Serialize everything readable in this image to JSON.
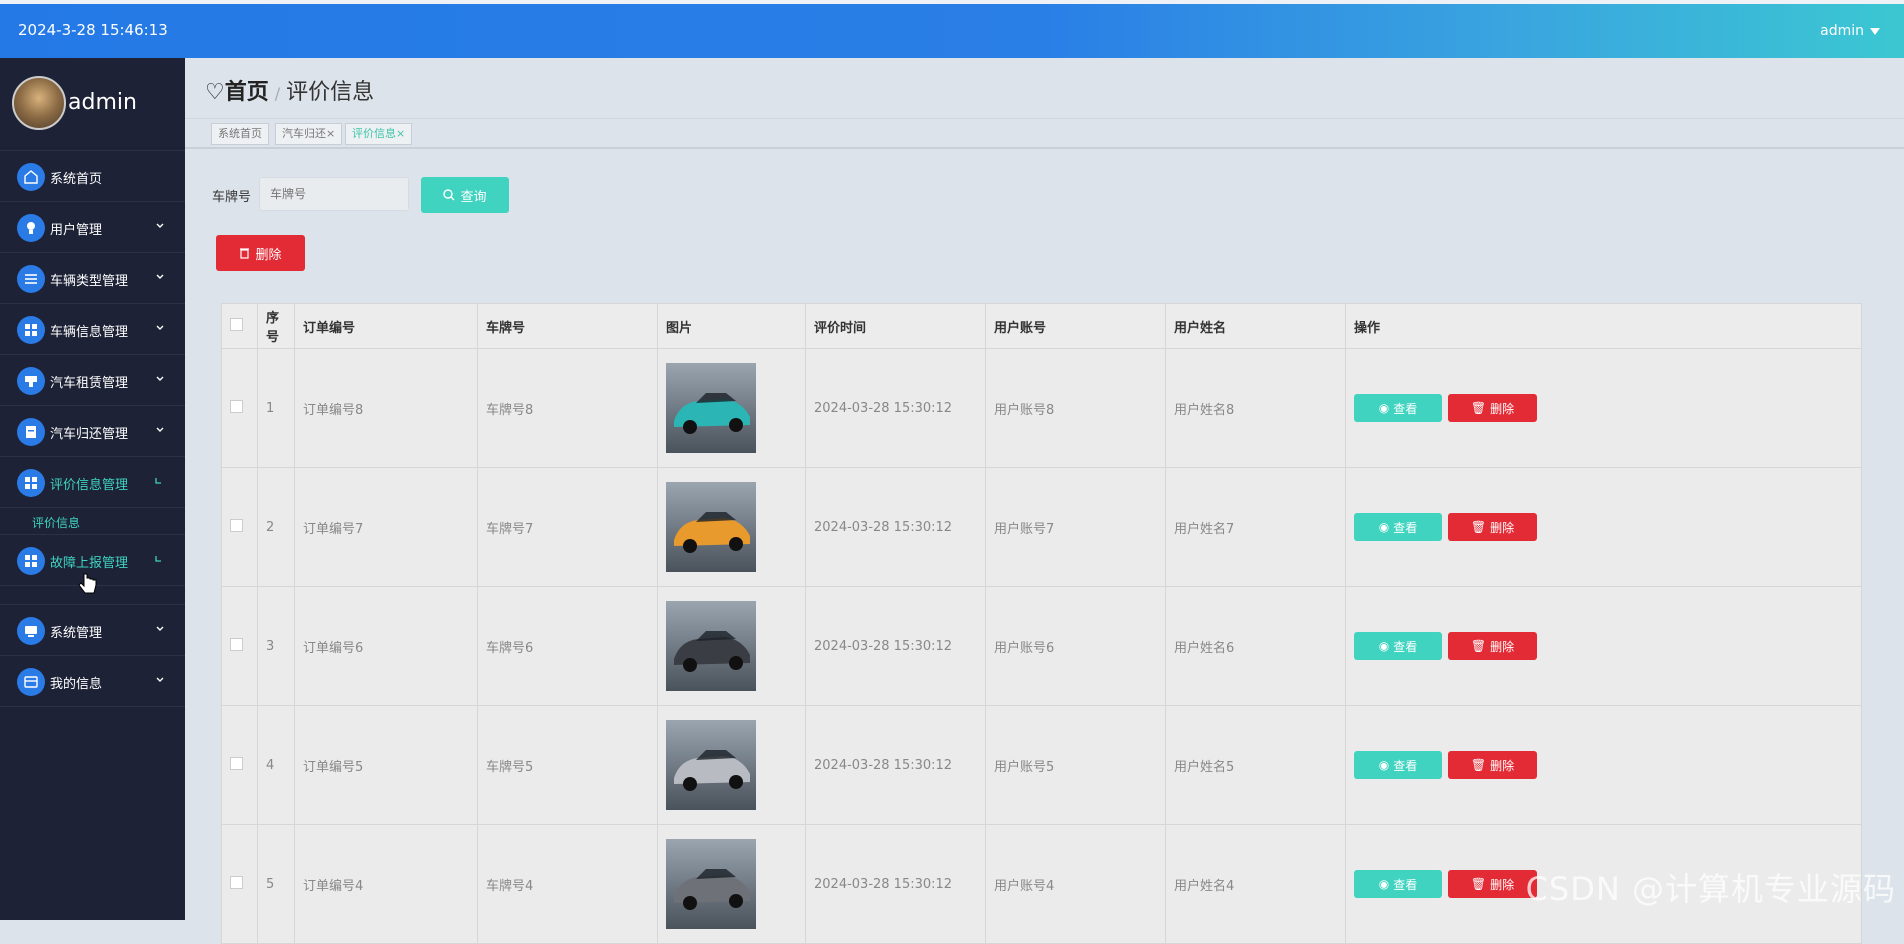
{
  "header": {
    "datetime": "2024-3-28 15:46:13",
    "user": "admin"
  },
  "sidebar": {
    "username": "admin",
    "items": [
      {
        "label": "系统首页",
        "icon": "home-icon",
        "expanded": false
      },
      {
        "label": "用户管理",
        "icon": "user-icon",
        "expanded": false
      },
      {
        "label": "车辆类型管理",
        "icon": "list-icon",
        "expanded": false
      },
      {
        "label": "车辆信息管理",
        "icon": "grid-icon",
        "expanded": false
      },
      {
        "label": "汽车租赁管理",
        "icon": "rent-icon",
        "expanded": false
      },
      {
        "label": "汽车归还管理",
        "icon": "return-icon",
        "expanded": false
      },
      {
        "label": "评价信息管理",
        "icon": "grid-icon",
        "expanded": true,
        "sub": "评价信息"
      },
      {
        "label": "故障上报管理",
        "icon": "grid-icon",
        "expanded": true
      },
      {
        "label": "系统管理",
        "icon": "system-icon",
        "expanded": false
      },
      {
        "label": "我的信息",
        "icon": "card-icon",
        "expanded": false
      }
    ]
  },
  "breadcrumb": {
    "home": "首页",
    "current": "评价信息"
  },
  "tabs": [
    {
      "label": "系统首页",
      "closable": false
    },
    {
      "label": "汽车归还",
      "closable": true
    },
    {
      "label": "评价信息",
      "closable": true,
      "active": true
    }
  ],
  "search": {
    "label": "车牌号",
    "placeholder": "车牌号",
    "button": "查询"
  },
  "toolbar": {
    "delete": "删除"
  },
  "table": {
    "headers": [
      "序号",
      "订单编号",
      "车牌号",
      "图片",
      "评价时间",
      "用户账号",
      "用户姓名",
      "操作"
    ],
    "view_label": "查看",
    "delete_label": "删除",
    "rows": [
      {
        "no": "1",
        "order": "订单编号8",
        "plate": "车牌号8",
        "time": "2024-03-28 15:30:12",
        "account": "用户账号8",
        "name": "用户姓名8",
        "car_color": "#2bb5b5"
      },
      {
        "no": "2",
        "order": "订单编号7",
        "plate": "车牌号7",
        "time": "2024-03-28 15:30:12",
        "account": "用户账号7",
        "name": "用户姓名7",
        "car_color": "#e89a2c"
      },
      {
        "no": "3",
        "order": "订单编号6",
        "plate": "车牌号6",
        "time": "2024-03-28 15:30:12",
        "account": "用户账号6",
        "name": "用户姓名6",
        "car_color": "#3a3d44"
      },
      {
        "no": "4",
        "order": "订单编号5",
        "plate": "车牌号5",
        "time": "2024-03-28 15:30:12",
        "account": "用户账号5",
        "name": "用户姓名5",
        "car_color": "#b8bcc2"
      },
      {
        "no": "5",
        "order": "订单编号4",
        "plate": "车牌号4",
        "time": "2024-03-28 15:30:12",
        "account": "用户账号4",
        "name": "用户姓名4",
        "car_color": "#6e7177"
      }
    ]
  },
  "watermark": "CSDN @计算机专业源码"
}
